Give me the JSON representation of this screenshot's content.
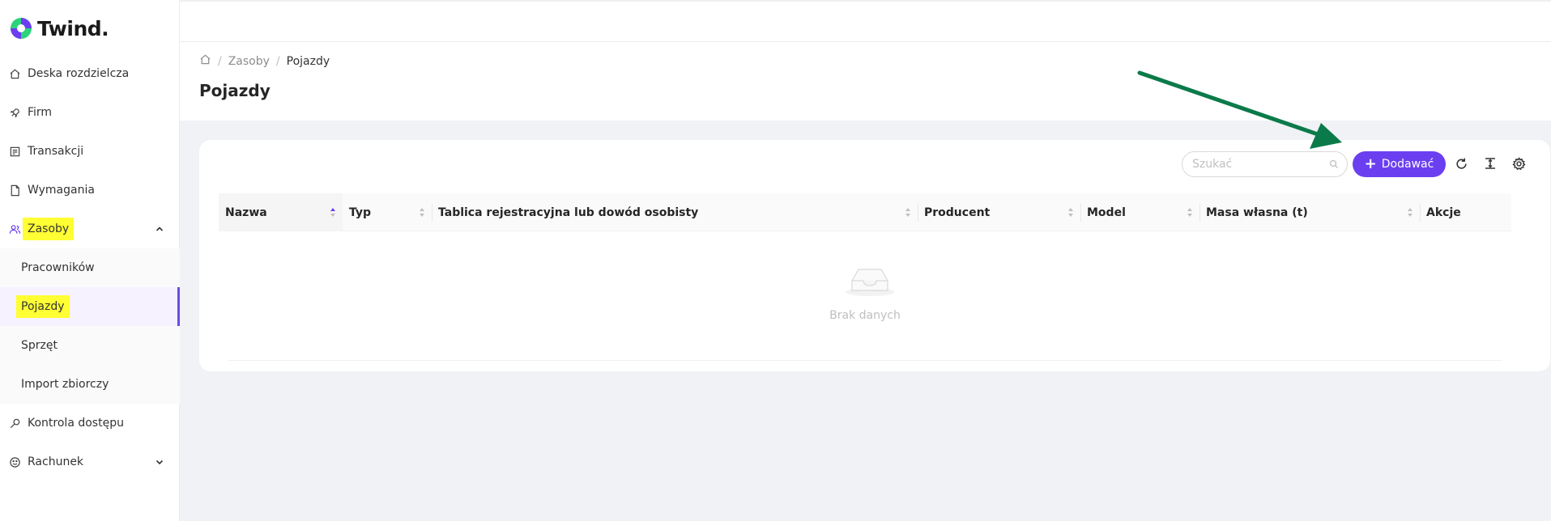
{
  "app": {
    "name": "Twind."
  },
  "sidebar": {
    "items": [
      {
        "label": "Deska rozdzielcza",
        "icon": "home-icon"
      },
      {
        "label": "Firm",
        "icon": "rocket-icon"
      },
      {
        "label": "Transakcji",
        "icon": "receipt-icon"
      },
      {
        "label": "Wymagania",
        "icon": "file-icon"
      },
      {
        "label": "Zasoby",
        "icon": "users-icon",
        "expanded": true
      },
      {
        "label": "Kontrola dostępu",
        "icon": "key-icon"
      },
      {
        "label": "Rachunek",
        "icon": "smile-icon"
      }
    ],
    "sub_items": [
      {
        "label": "Pracowników"
      },
      {
        "label": "Pojazdy",
        "active": true
      },
      {
        "label": "Sprzęt"
      },
      {
        "label": "Import zbiorczy"
      }
    ]
  },
  "breadcrumb": {
    "items": [
      "Zasoby",
      "Pojazdy"
    ]
  },
  "page": {
    "title": "Pojazdy"
  },
  "toolbar": {
    "search_placeholder": "Szukać",
    "add_label": "Dodawać"
  },
  "table": {
    "columns": [
      "Nazwa",
      "Typ",
      "Tablica rejestracyjna lub dowód osobisty",
      "Producent",
      "Model",
      "Masa własna (t)",
      "Akcje"
    ],
    "empty_text": "Brak danych"
  },
  "colors": {
    "accent": "#6b3ff0",
    "highlight": "#ffff33",
    "arrow": "#0b7a4a",
    "logo_green": "#2bd37a",
    "logo_purple": "#6b3ff0"
  }
}
